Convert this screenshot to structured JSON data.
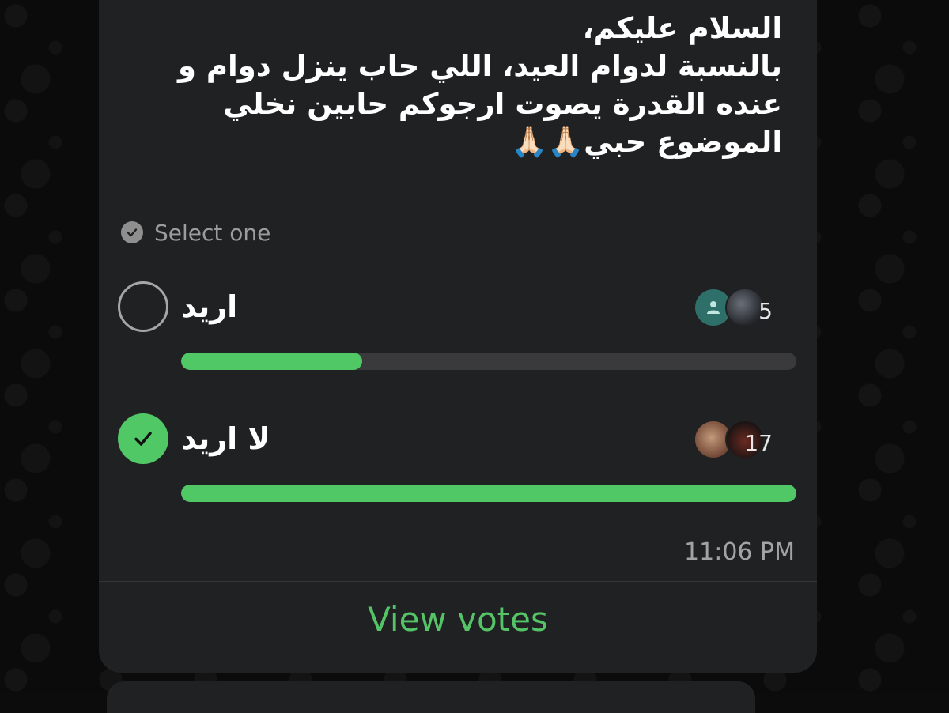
{
  "message": {
    "text": "السلام عليكم،\nبالنسبة لدوام العيد، اللي حاب ينزل دوام و\nعنده القدرة يصوت ارجوكم حابين نخلي\nالموضوع حبي🙏🏻🙏🏻"
  },
  "poll": {
    "instruction": "Select one",
    "options": [
      {
        "label": "اريد",
        "votes": "5",
        "fraction": 0.294,
        "selected": false
      },
      {
        "label": "لا اريد",
        "votes": "17",
        "fraction": 1.0,
        "selected": true
      }
    ],
    "timestamp": "11:06 PM",
    "view_votes_label": "View votes"
  },
  "colors": {
    "accent_green": "#4fc865",
    "bubble": "#202123",
    "track": "#3a3a3c"
  }
}
